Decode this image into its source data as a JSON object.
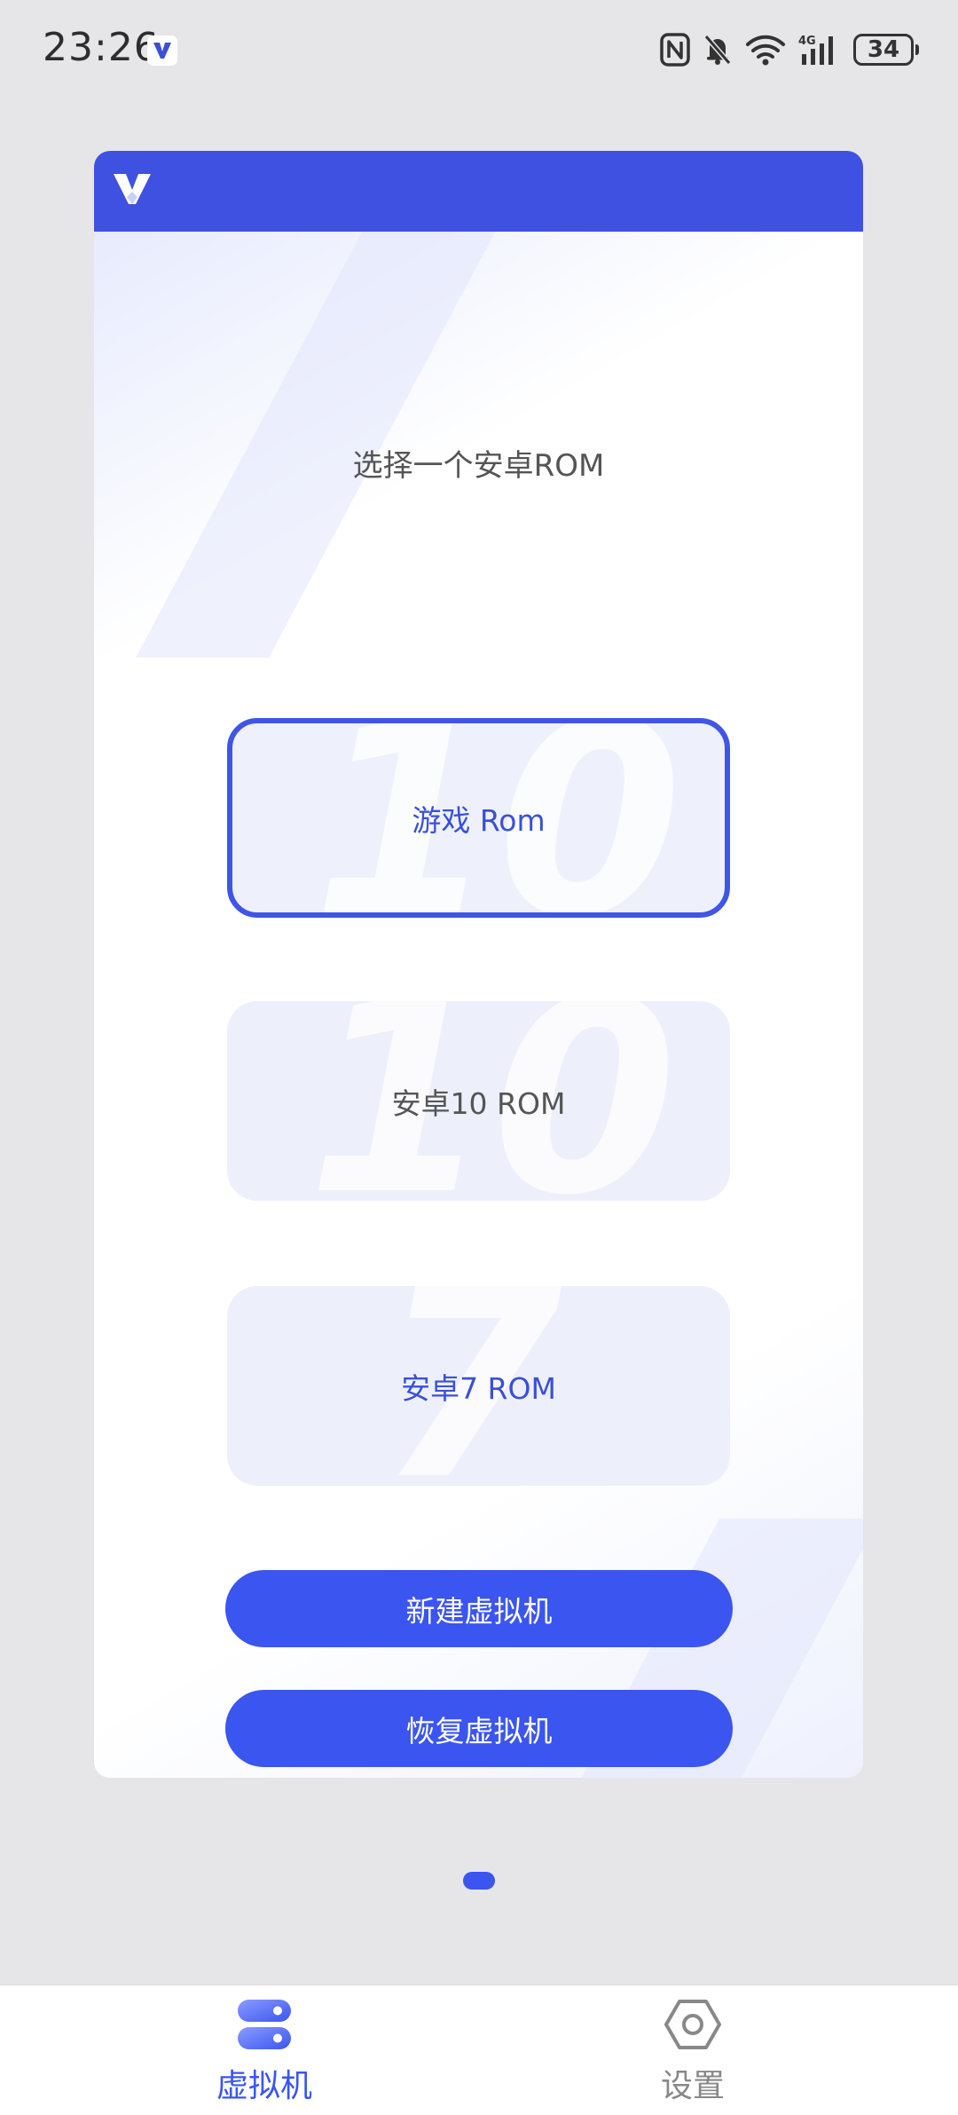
{
  "status_bar": {
    "time": "23:26",
    "battery": "34"
  },
  "main": {
    "prompt": "选择一个安卓ROM",
    "rom_options": [
      {
        "label": "游戏 Rom",
        "watermark": "10",
        "selected": true
      },
      {
        "label": "安卓10 ROM",
        "watermark": "10",
        "selected": false
      },
      {
        "label": "安卓7 ROM",
        "watermark": "7",
        "selected": false
      }
    ],
    "buttons": {
      "new_vm": "新建虚拟机",
      "restore_vm": "恢复虚拟机"
    }
  },
  "bottom_nav": {
    "items": [
      {
        "label": "虚拟机",
        "icon": "vm-toggle-icon",
        "active": true
      },
      {
        "label": "设置",
        "icon": "hexagon-settings-icon",
        "active": false
      }
    ]
  },
  "colors": {
    "accent": "#3b55f0",
    "header": "#3f51e0",
    "background": "#e6e6e8"
  }
}
